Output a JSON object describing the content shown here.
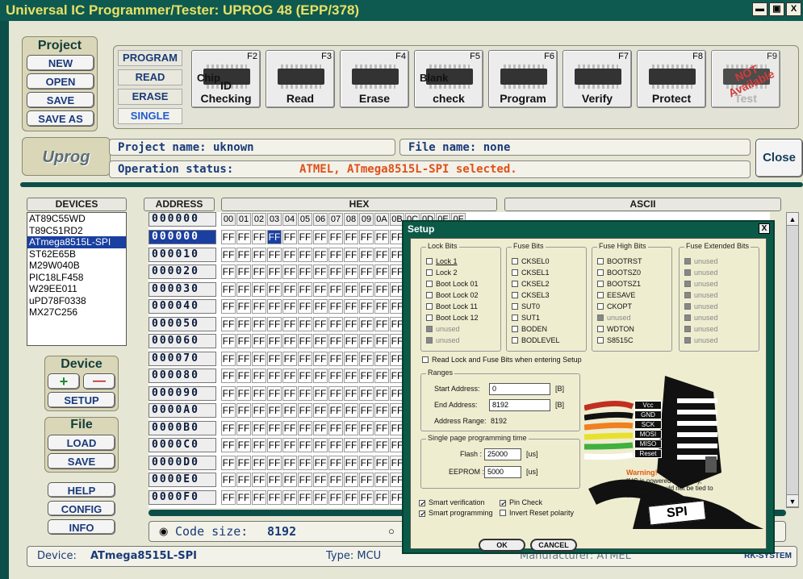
{
  "window": {
    "title": "Universal IC Programmer/Tester: UPROG 48 (EPP/378)",
    "btn_min": "▬",
    "btn_max": "▣",
    "btn_close": "X"
  },
  "project": {
    "label": "Project",
    "new": "NEW",
    "open": "OPEN",
    "save": "SAVE",
    "save_as": "SAVE AS"
  },
  "modes": {
    "program": "PROGRAM",
    "read": "READ",
    "erase": "ERASE",
    "single": "SINGLE"
  },
  "tools": [
    {
      "key": "F2",
      "label": "ID\nChecking",
      "top": "Chip",
      "icon": "magnifier-chip-icon"
    },
    {
      "key": "F3",
      "label": "Read",
      "icon": "read-chip-icon"
    },
    {
      "key": "F4",
      "label": "Erase",
      "icon": "eraser-chip-icon"
    },
    {
      "key": "F5",
      "label": "check",
      "top": "Blank",
      "icon": "blank-chip-icon"
    },
    {
      "key": "F6",
      "label": "Program",
      "icon": "program-chip-icon"
    },
    {
      "key": "F7",
      "label": "Verify",
      "icon": "verify-chip-icon"
    },
    {
      "key": "F8",
      "label": "Protect",
      "icon": "lock-chip-icon"
    },
    {
      "key": "F9",
      "label": "Test",
      "stamp": "NOT Available",
      "icon": "test-chip-icon"
    }
  ],
  "logo": "Uprog",
  "project_name": "Project name:  uknown",
  "file_name": "File name:  none",
  "op_status_label": "Operation status:",
  "op_status_value": "ATMEL, ATmega8515L-SPI selected.",
  "close": "Close",
  "devices_header": "DEVICES",
  "devices": [
    "AT89C55WD",
    "T89C51RD2",
    "ATmega8515L-SPI",
    "ST62E65B",
    "M29W040B",
    "PIC18LF458",
    "W29EE011",
    "uPD78F0338",
    "MX27C256"
  ],
  "device_group": {
    "label": "Device",
    "add": "+",
    "remove": "—",
    "setup": "SETUP"
  },
  "file_group": {
    "label": "File",
    "load": "LOAD",
    "save": "SAVE"
  },
  "help": "HELP",
  "config": "CONFIG",
  "info": "INFO",
  "address_header": "ADDRESS",
  "hex_header": "HEX",
  "ascii_header": "ASCII",
  "address_first": "000000",
  "addresses": [
    "000000",
    "000010",
    "000020",
    "000030",
    "000040",
    "000050",
    "000060",
    "000070",
    "000080",
    "000090",
    "0000A0",
    "0000B0",
    "0000C0",
    "0000D0",
    "0000E0",
    "0000F0"
  ],
  "hex_cols": [
    "00",
    "01",
    "02",
    "03",
    "04",
    "05",
    "06",
    "07",
    "08",
    "09",
    "0A",
    "0B",
    "0C",
    "0D",
    "0E",
    "0F"
  ],
  "hex_value": "FF",
  "code_size_label": "Code size:",
  "code_size_value": "8192",
  "status": {
    "device_label": "Device:",
    "device": "ATmega8515L-SPI",
    "type": "Type: MCU",
    "manufacturer": "Manufacturer: ATMEL",
    "brand": "RK-SYSTEM"
  },
  "setup": {
    "title": "Setup",
    "close": "X",
    "lock_bits": {
      "title": "Lock Bits",
      "items": [
        "Lock 1",
        "Lock 2",
        "Boot Lock 01",
        "Boot Lock 02",
        "Boot Lock 11",
        "Boot Lock 12",
        "unused",
        "unused"
      ]
    },
    "fuse_bits": {
      "title": "Fuse Bits",
      "items": [
        "CKSEL0",
        "CKSEL1",
        "CKSEL2",
        "CKSEL3",
        "SUT0",
        "SUT1",
        "BODEN",
        "BODLEVEL"
      ]
    },
    "fuse_high": {
      "title": "Fuse High Bits",
      "items": [
        "BOOTRST",
        "BOOTSZ0",
        "BOOTSZ1",
        "EESAVE",
        "CKOPT",
        "unused",
        "WDTON",
        "S8515C"
      ]
    },
    "fuse_ext": {
      "title": "Fuse Extended Bits",
      "items": [
        "unused",
        "unused",
        "unused",
        "unused",
        "unused",
        "unused",
        "unused",
        "unused"
      ]
    },
    "read_on_enter": "Read Lock and Fuse Bits when entering Setup",
    "ranges": {
      "title": "Ranges",
      "start_label": "Start Address:",
      "start": "0",
      "end_label": "End Address:",
      "end": "8192",
      "unit": "[B]",
      "range_label": "Address Range:",
      "range": "8192"
    },
    "timing": {
      "title": "Single page programming time",
      "flash_label": "Flash :",
      "flash": "25000",
      "eeprom_label": "EEPROM :",
      "eeprom": "5000",
      "unit": "[us]"
    },
    "smart_verification": "Smart verification",
    "smart_programming": "Smart programming",
    "pin_check": "Pin Check",
    "invert_reset": "Invert Reset polarity",
    "pins": [
      "Vcc",
      "GND",
      "SCK",
      "MOSI",
      "MISO",
      "Reset"
    ],
    "warning_title": "Warning!",
    "warning_text": "If IC is powered externally, 'Vcc' wire should not be tied to the target.",
    "spi": "SPI",
    "ok": "OK",
    "cancel": "CANCEL"
  }
}
